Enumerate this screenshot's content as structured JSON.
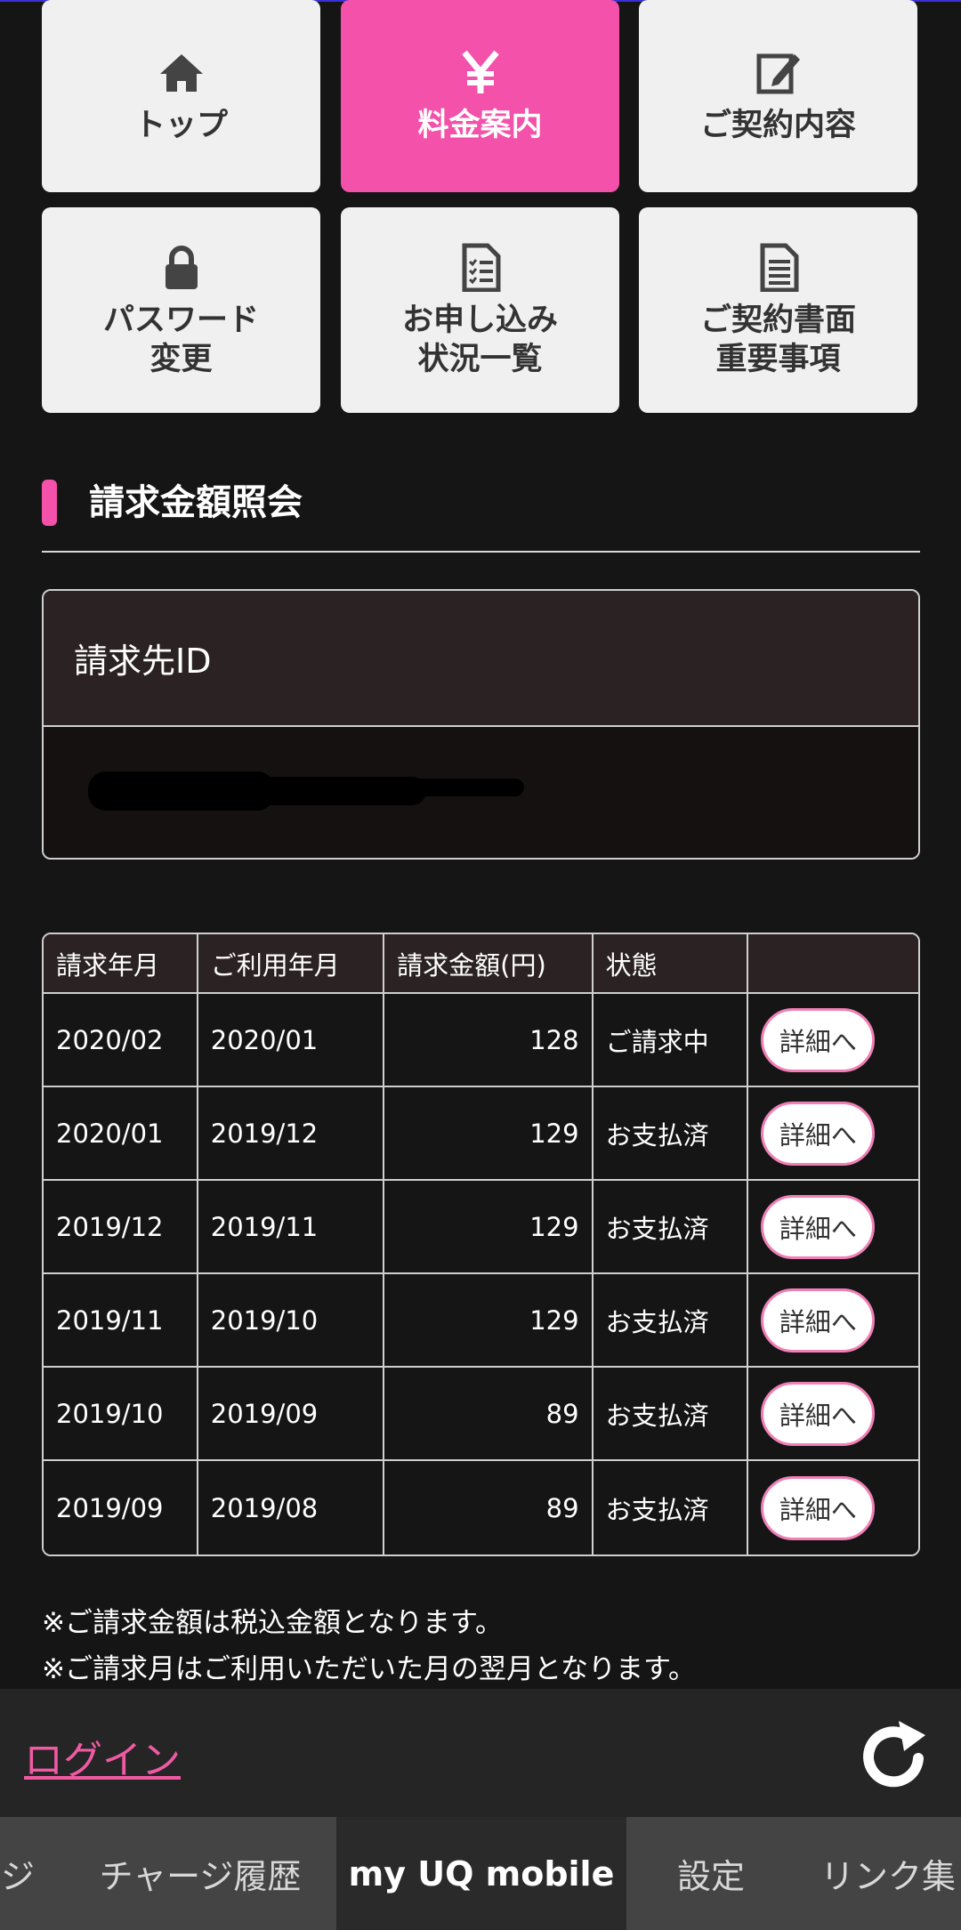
{
  "tiles": [
    {
      "label": "トップ",
      "icon": "home-icon"
    },
    {
      "label": "料金案内",
      "icon": "yen-icon"
    },
    {
      "label": "ご契約内容",
      "icon": "edit-icon"
    },
    {
      "label": "パスワード\n変更",
      "icon": "lock-icon"
    },
    {
      "label": "お申し込み\n状況一覧",
      "icon": "checklist-icon"
    },
    {
      "label": "ご契約書面\n重要事項",
      "icon": "document-icon"
    }
  ],
  "section": {
    "title": "請求金額照会"
  },
  "billing_id": {
    "label": "請求先ID"
  },
  "table": {
    "headers": [
      "請求年月",
      "ご利用年月",
      "請求金額(円)",
      "状態",
      ""
    ],
    "rows": [
      {
        "bill_month": "2020/02",
        "usage_month": "2020/01",
        "amount": "128",
        "status": "ご請求中",
        "button": "詳細へ"
      },
      {
        "bill_month": "2020/01",
        "usage_month": "2019/12",
        "amount": "129",
        "status": "お支払済",
        "button": "詳細へ"
      },
      {
        "bill_month": "2019/12",
        "usage_month": "2019/11",
        "amount": "129",
        "status": "お支払済",
        "button": "詳細へ"
      },
      {
        "bill_month": "2019/11",
        "usage_month": "2019/10",
        "amount": "129",
        "status": "お支払済",
        "button": "詳細へ"
      },
      {
        "bill_month": "2019/10",
        "usage_month": "2019/09",
        "amount": "89",
        "status": "お支払済",
        "button": "詳細へ"
      },
      {
        "bill_month": "2019/09",
        "usage_month": "2019/08",
        "amount": "89",
        "status": "お支払済",
        "button": "詳細へ"
      }
    ]
  },
  "notes": [
    "※ご請求金額は税込金額となります。",
    "※ご請求月はご利用いただいた月の翌月となります。"
  ],
  "footer": {
    "login_label": "ログイン",
    "refresh_icon": "refresh-icon"
  },
  "tabs": [
    {
      "label": "ジ",
      "active": false
    },
    {
      "label": "チャージ履歴",
      "active": false
    },
    {
      "label": "my UQ mobile",
      "active": true
    },
    {
      "label": "設定",
      "active": false
    },
    {
      "label": "リンク集",
      "active": false
    }
  ],
  "colors": {
    "accent": "#f351aa",
    "background": "#151515",
    "tile": "#f0f0f0",
    "header_cell": "#2b2323"
  }
}
